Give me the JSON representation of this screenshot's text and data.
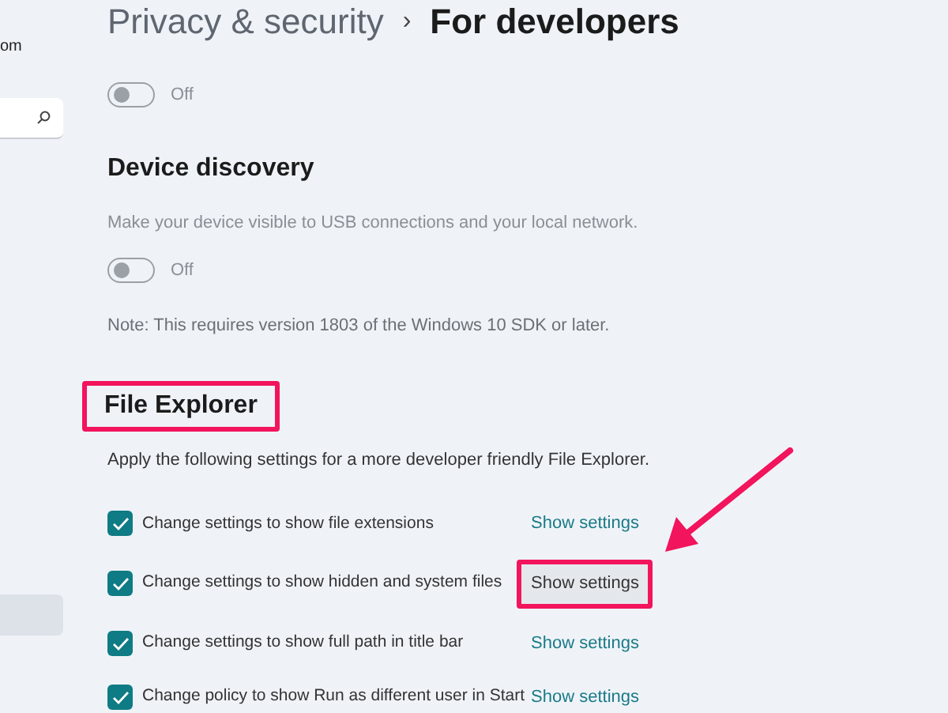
{
  "breadcrumb": [
    {
      "label": "Privacy & security",
      "current": false
    },
    {
      "label": "For developers",
      "current": true
    }
  ],
  "breadcrumb_separator": "›",
  "sidebar": {
    "account_fragment": "om",
    "items": [
      {
        "selected": true
      }
    ]
  },
  "sections": [
    {
      "kind": "toggle",
      "toggle": {
        "on": false,
        "label": "Off"
      }
    },
    {
      "kind": "block",
      "title": "Device discovery",
      "highlighted": false,
      "description": "Make your device visible to USB connections and your local network.",
      "toggle": {
        "on": false,
        "label": "Off"
      },
      "note": "Note: This requires version 1803 of the Windows 10 SDK or later."
    },
    {
      "kind": "checklist",
      "title": "File Explorer",
      "highlighted": true,
      "description": "Apply the following settings for a more developer friendly File Explorer.",
      "items": [
        {
          "label": "Change settings to show file extensions",
          "checked": true,
          "link": "Show settings",
          "highlighted": false
        },
        {
          "label": "Change settings to show hidden and system files",
          "checked": true,
          "link": "Show settings",
          "highlighted": true
        },
        {
          "label": "Change settings to show full path in title bar",
          "checked": true,
          "link": "Show settings",
          "highlighted": false
        },
        {
          "label": "Change policy to show Run as different user in Start",
          "checked": true,
          "link": "Show settings",
          "highlighted": false
        }
      ]
    }
  ]
}
